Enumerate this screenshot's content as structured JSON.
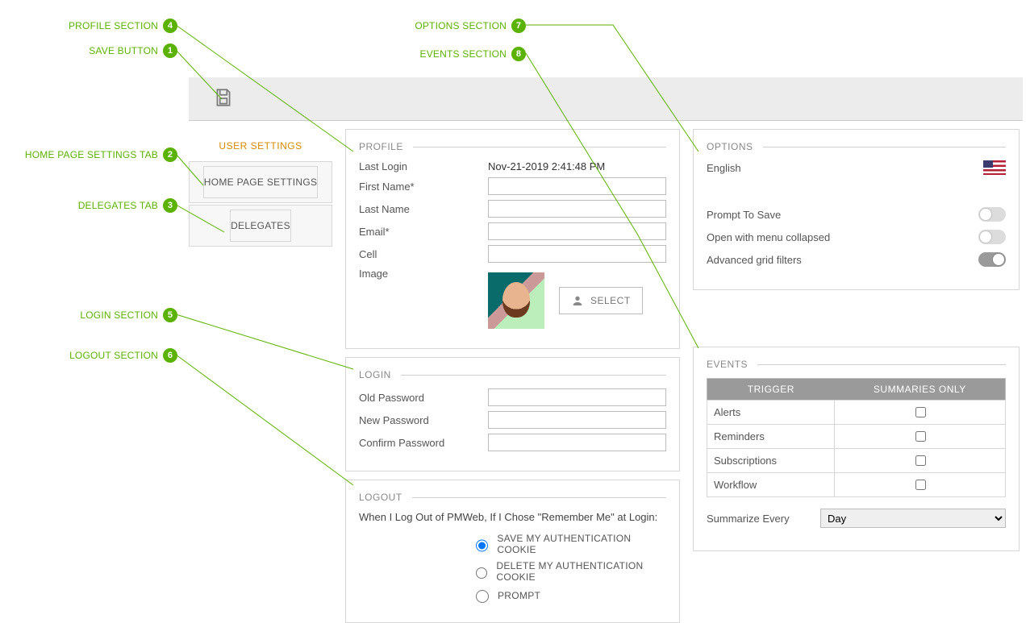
{
  "annotations": {
    "1": "SAVE BUTTON",
    "2": "HOME PAGE SETTINGS TAB",
    "3": "DELEGATES TAB",
    "4": "PROFILE SECTION",
    "5": "LOGIN SECTION",
    "6": "LOGOUT SECTION",
    "7": "OPTIONS SECTION",
    "8": "EVENTS SECTION"
  },
  "sidebar": {
    "title": "USER SETTINGS",
    "tabs": [
      "HOME PAGE SETTINGS",
      "DELEGATES"
    ]
  },
  "profile": {
    "title": "PROFILE",
    "last_login_label": "Last Login",
    "last_login_value": "Nov-21-2019 2:41:48 PM",
    "first_name_label": "First Name*",
    "first_name_value": "",
    "last_name_label": "Last Name",
    "last_name_value": "",
    "email_label": "Email*",
    "email_value": "",
    "cell_label": "Cell",
    "cell_value": "",
    "image_label": "Image",
    "select_label": "SELECT"
  },
  "login": {
    "title": "LOGIN",
    "old_pw_label": "Old Password",
    "new_pw_label": "New Password",
    "confirm_pw_label": "Confirm Password"
  },
  "logout": {
    "title": "LOGOUT",
    "note": "When I Log Out of PMWeb, If I Chose \"Remember Me\" at Login:",
    "opt_save": "SAVE MY AUTHENTICATION COOKIE",
    "opt_delete": "DELETE MY AUTHENTICATION COOKIE",
    "opt_prompt": "PROMPT"
  },
  "options": {
    "title": "OPTIONS",
    "language": "English",
    "prompt_save": "Prompt To Save",
    "menu_collapsed": "Open with menu collapsed",
    "adv_filters": "Advanced grid filters"
  },
  "events": {
    "title": "EVENTS",
    "col_trigger": "TRIGGER",
    "col_summary": "SUMMARIES ONLY",
    "rows": [
      "Alerts",
      "Reminders",
      "Subscriptions",
      "Workflow"
    ],
    "summarize_label": "Summarize Every",
    "summarize_value": "Day"
  }
}
